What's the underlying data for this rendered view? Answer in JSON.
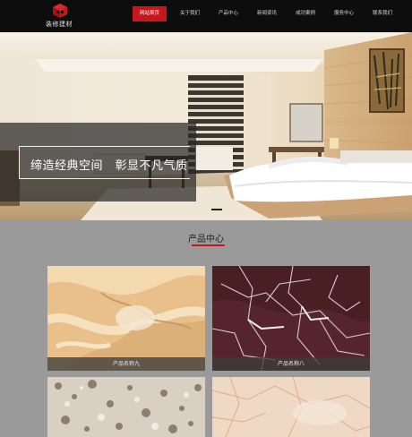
{
  "header": {
    "logo_text": "装修建材",
    "nav": [
      {
        "label": "网站首页",
        "active": true
      },
      {
        "label": "关于我们",
        "active": false
      },
      {
        "label": "产品中心",
        "active": false
      },
      {
        "label": "新闻资讯",
        "active": false
      },
      {
        "label": "成功案例",
        "active": false
      },
      {
        "label": "服务中心",
        "active": false
      },
      {
        "label": "联系我们",
        "active": false
      }
    ]
  },
  "banner": {
    "slogan": "缔造经典空间　彰显不凡气质"
  },
  "products": {
    "title": "产品中心",
    "items": [
      {
        "name": "产品名称九"
      },
      {
        "name": "产品名称八"
      },
      {
        "name": ""
      },
      {
        "name": ""
      }
    ]
  },
  "colors": {
    "accent": "#c8161d",
    "header_bg": "#0d0d0d",
    "page_bg": "#9a9a9a"
  }
}
